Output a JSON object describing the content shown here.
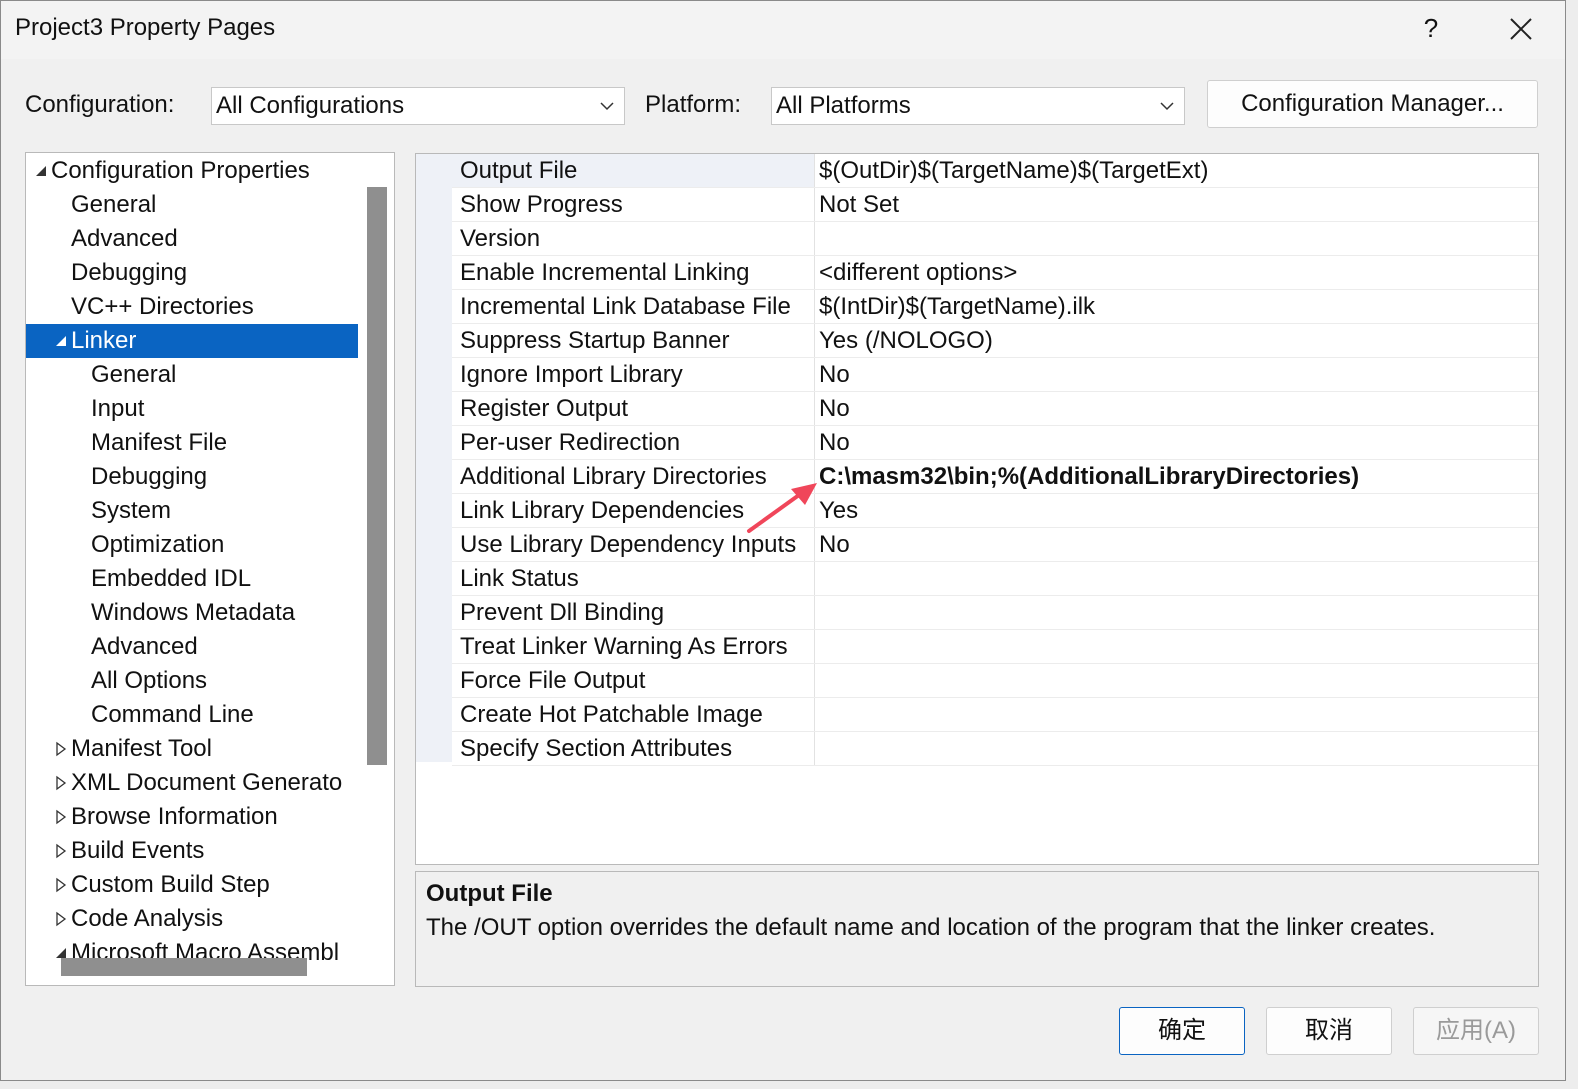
{
  "window": {
    "title": "Project3 Property Pages",
    "help_label": "?"
  },
  "toolbar": {
    "configuration_label": "Configuration:",
    "configuration_value": "All Configurations",
    "platform_label": "Platform:",
    "platform_value": "All Platforms",
    "config_manager_label": "Configuration Manager..."
  },
  "tree": {
    "items": [
      {
        "label": "Configuration Properties",
        "level": 0,
        "expander": "expanded"
      },
      {
        "label": "General",
        "level": 1,
        "expander": "none"
      },
      {
        "label": "Advanced",
        "level": 1,
        "expander": "none"
      },
      {
        "label": "Debugging",
        "level": 1,
        "expander": "none"
      },
      {
        "label": "VC++ Directories",
        "level": 1,
        "expander": "none"
      },
      {
        "label": "Linker",
        "level": 1,
        "expander": "expanded",
        "selected": true
      },
      {
        "label": "General",
        "level": 2,
        "expander": "none"
      },
      {
        "label": "Input",
        "level": 2,
        "expander": "none"
      },
      {
        "label": "Manifest File",
        "level": 2,
        "expander": "none"
      },
      {
        "label": "Debugging",
        "level": 2,
        "expander": "none"
      },
      {
        "label": "System",
        "level": 2,
        "expander": "none"
      },
      {
        "label": "Optimization",
        "level": 2,
        "expander": "none"
      },
      {
        "label": "Embedded IDL",
        "level": 2,
        "expander": "none"
      },
      {
        "label": "Windows Metadata",
        "level": 2,
        "expander": "none"
      },
      {
        "label": "Advanced",
        "level": 2,
        "expander": "none"
      },
      {
        "label": "All Options",
        "level": 2,
        "expander": "none"
      },
      {
        "label": "Command Line",
        "level": 2,
        "expander": "none"
      },
      {
        "label": "Manifest Tool",
        "level": 1,
        "expander": "collapsed"
      },
      {
        "label": "XML Document Generato",
        "level": 1,
        "expander": "collapsed"
      },
      {
        "label": "Browse Information",
        "level": 1,
        "expander": "collapsed"
      },
      {
        "label": "Build Events",
        "level": 1,
        "expander": "collapsed"
      },
      {
        "label": "Custom Build Step",
        "level": 1,
        "expander": "collapsed"
      },
      {
        "label": "Code Analysis",
        "level": 1,
        "expander": "collapsed"
      },
      {
        "label": "Microsoft Macro Assembl",
        "level": 1,
        "expander": "expanded"
      }
    ]
  },
  "grid": {
    "rows": [
      {
        "name": "Output File",
        "value": "$(OutDir)$(TargetName)$(TargetExt)",
        "selected": true
      },
      {
        "name": "Show Progress",
        "value": "Not Set"
      },
      {
        "name": "Version",
        "value": ""
      },
      {
        "name": "Enable Incremental Linking",
        "value": "<different options>"
      },
      {
        "name": "Incremental Link Database File",
        "value": "$(IntDir)$(TargetName).ilk"
      },
      {
        "name": "Suppress Startup Banner",
        "value": "Yes (/NOLOGO)"
      },
      {
        "name": "Ignore Import Library",
        "value": "No"
      },
      {
        "name": "Register Output",
        "value": "No"
      },
      {
        "name": "Per-user Redirection",
        "value": "No"
      },
      {
        "name": "Additional Library Directories",
        "value": "C:\\masm32\\bin;%(AdditionalLibraryDirectories)",
        "bold": true
      },
      {
        "name": "Link Library Dependencies",
        "value": "Yes"
      },
      {
        "name": "Use Library Dependency Inputs",
        "value": "No"
      },
      {
        "name": "Link Status",
        "value": ""
      },
      {
        "name": "Prevent Dll Binding",
        "value": ""
      },
      {
        "name": "Treat Linker Warning As Errors",
        "value": ""
      },
      {
        "name": "Force File Output",
        "value": ""
      },
      {
        "name": "Create Hot Patchable Image",
        "value": ""
      },
      {
        "name": "Specify Section Attributes",
        "value": ""
      }
    ]
  },
  "description": {
    "title": "Output File",
    "text": "The /OUT option overrides the default name and location of the program that the linker creates."
  },
  "footer": {
    "ok_label": "确定",
    "cancel_label": "取消",
    "apply_label": "应用(A)"
  },
  "colors": {
    "selection": "#0a64c2",
    "annotation_arrow": "#f0465a"
  }
}
